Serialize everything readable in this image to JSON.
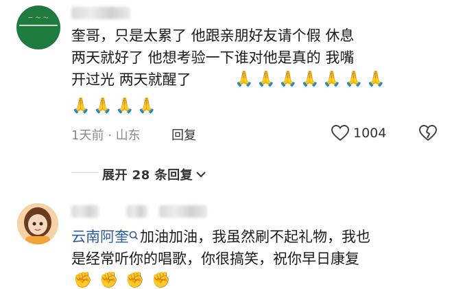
{
  "comment1": {
    "text_line1": "奎哥，只是太累了  他跟亲朋好友请个假  休息",
    "text_line2": "两天就好了  他想考验一下谁对他是真的  我嘴",
    "text_line3": "开过光  两天就醒了",
    "emoji_row1_count": 7,
    "emoji_row2_count": 4,
    "time": "1天前",
    "dot": "·",
    "location": "山东",
    "reply_label": "回复",
    "like_count": "1004",
    "icons": [
      "heart-icon",
      "dislike-heart-icon"
    ]
  },
  "expand": {
    "label": "展开 28 条回复",
    "chevron": "chevron-down-icon"
  },
  "comment2": {
    "author": "云南阿奎",
    "author_badge": "search-badge-icon",
    "text_line1": "加油加油，我虽然刷不起礼物，我也",
    "text_line2": "是经常听你的唱歌，你很搞笑，祝你早日康复",
    "emoji_count": 4
  },
  "colors": {
    "author_blue": "#2e5a9e",
    "meta_gray": "#8a8a8a",
    "avatar1_green": "#1f7a3e"
  }
}
